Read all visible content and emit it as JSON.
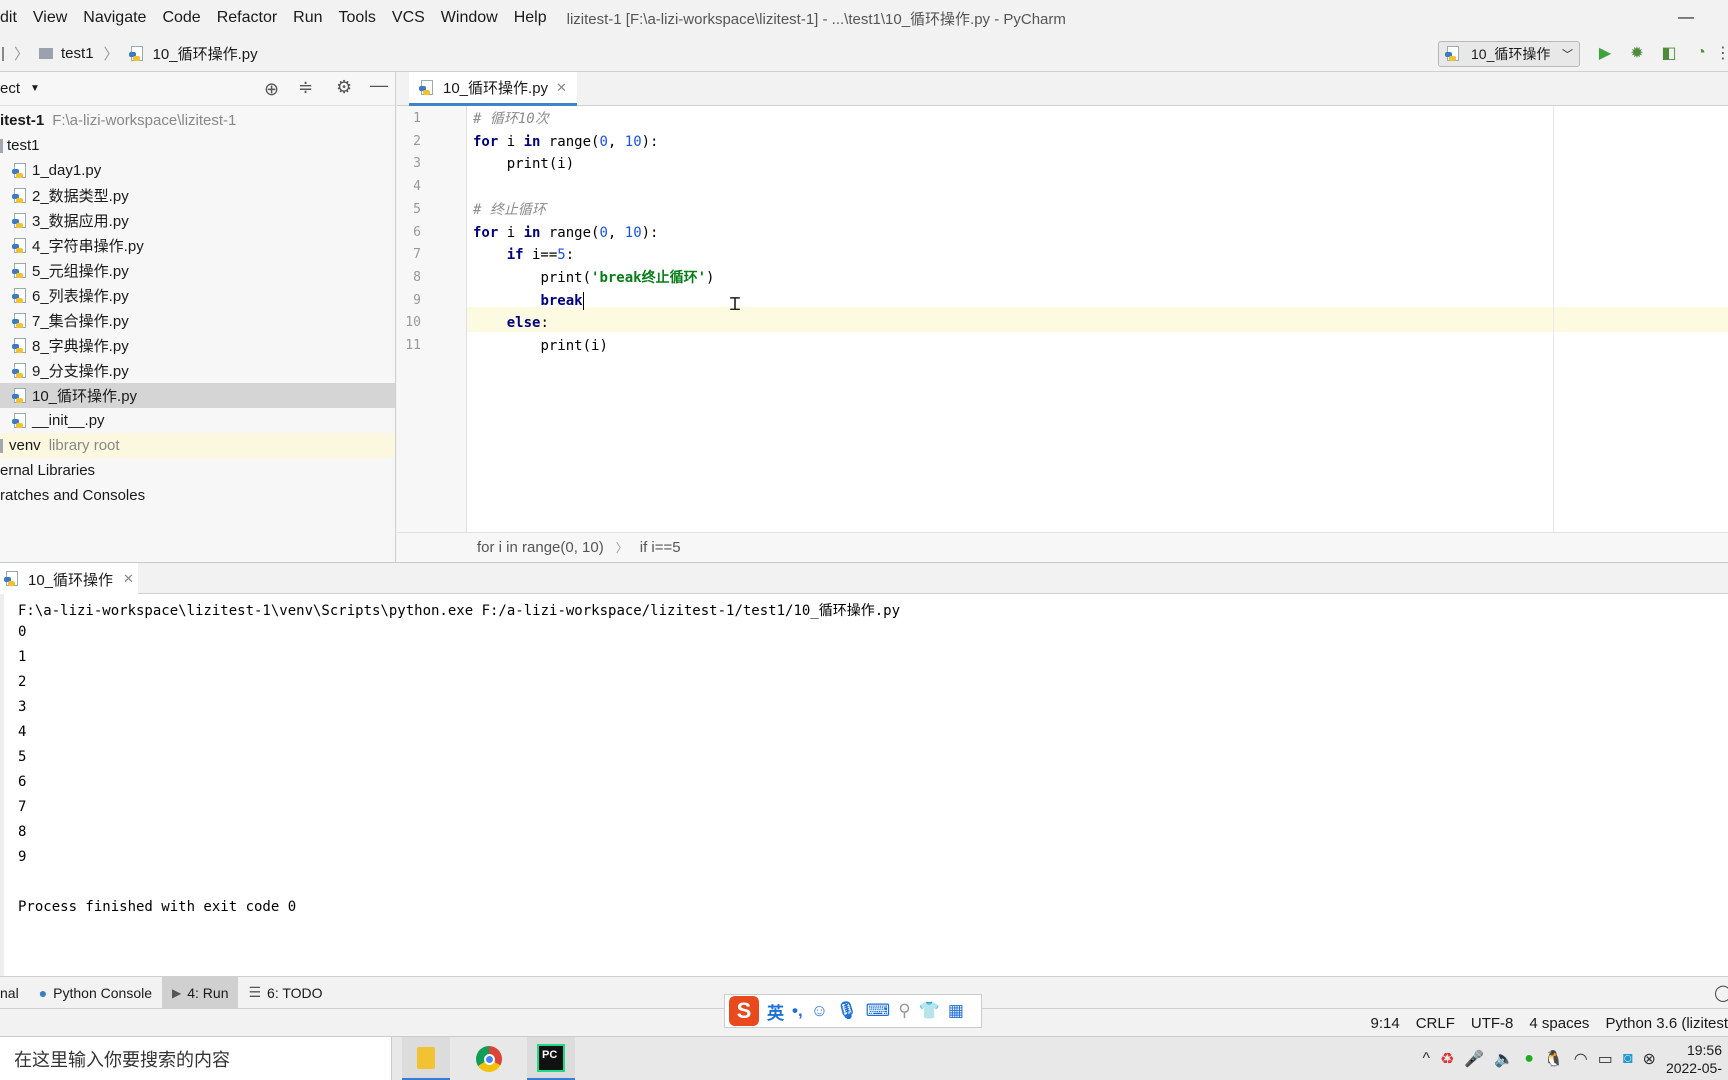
{
  "menubar": {
    "items": [
      "dit",
      "View",
      "Navigate",
      "Code",
      "Refactor",
      "Run",
      "Tools",
      "VCS",
      "Window",
      "Help"
    ],
    "title": "lizitest-1 [F:\\a-lizi-workspace\\lizitest-1] - ...\\test1\\10_循环操作.py - PyCharm",
    "minimize": "—"
  },
  "navbar": {
    "crumb_folder": "test1",
    "crumb_file": "10_循环操作.py",
    "run_config": "10_循环操作"
  },
  "project": {
    "header_label": "ect",
    "root_name": "itest-1",
    "root_path": "F:\\a-lizi-workspace\\lizitest-1",
    "folder": "test1",
    "files": [
      "1_day1.py",
      "2_数据类型.py",
      "3_数据应用.py",
      "4_字符串操作.py",
      "5_元组操作.py",
      "6_列表操作.py",
      "7_集合操作.py",
      "8_字典操作.py",
      "9_分支操作.py",
      "10_循环操作.py",
      "__init__.py"
    ],
    "selected_file": "10_循环操作.py",
    "venv_name": "venv",
    "venv_note": "library root",
    "external_libraries": "ernal Libraries",
    "scratches": "ratches and Consoles"
  },
  "editor": {
    "tab_label": "10_循环操作.py",
    "line_numbers": [
      "1",
      "2",
      "3",
      "4",
      "5",
      "6",
      "7",
      "8",
      "9",
      "10",
      "11"
    ],
    "lines": [
      {
        "indent": "",
        "tokens": [
          {
            "c": "cm",
            "t": "# 循环10次"
          }
        ]
      },
      {
        "indent": "",
        "tokens": [
          {
            "c": "kw",
            "t": "for"
          },
          {
            "c": "fn",
            "t": " i "
          },
          {
            "c": "kw",
            "t": "in"
          },
          {
            "c": "fn",
            "t": " range("
          },
          {
            "c": "num",
            "t": "0"
          },
          {
            "c": "fn",
            "t": ", "
          },
          {
            "c": "num",
            "t": "10"
          },
          {
            "c": "fn",
            "t": "):"
          }
        ]
      },
      {
        "indent": "    ",
        "tokens": [
          {
            "c": "fn",
            "t": "print(i)"
          }
        ]
      },
      {
        "indent": "",
        "tokens": []
      },
      {
        "indent": "",
        "tokens": [
          {
            "c": "cm",
            "t": "# 终止循环"
          }
        ]
      },
      {
        "indent": "",
        "tokens": [
          {
            "c": "kw",
            "t": "for"
          },
          {
            "c": "fn",
            "t": " i "
          },
          {
            "c": "kw",
            "t": "in"
          },
          {
            "c": "fn",
            "t": " range("
          },
          {
            "c": "num",
            "t": "0"
          },
          {
            "c": "fn",
            "t": ", "
          },
          {
            "c": "num",
            "t": "10"
          },
          {
            "c": "fn",
            "t": "):"
          }
        ]
      },
      {
        "indent": "    ",
        "tokens": [
          {
            "c": "kw",
            "t": "if"
          },
          {
            "c": "fn",
            "t": " i=="
          },
          {
            "c": "num",
            "t": "5"
          },
          {
            "c": "fn",
            "t": ":"
          }
        ]
      },
      {
        "indent": "        ",
        "tokens": [
          {
            "c": "fn",
            "t": "print("
          },
          {
            "c": "str",
            "t": "'break终止循环'"
          },
          {
            "c": "fn",
            "t": ")"
          }
        ]
      },
      {
        "indent": "        ",
        "tokens": [
          {
            "c": "kw",
            "t": "break"
          }
        ]
      },
      {
        "indent": "    ",
        "tokens": [
          {
            "c": "kw",
            "t": "else"
          },
          {
            "c": "fn",
            "t": ":"
          }
        ]
      },
      {
        "indent": "        ",
        "tokens": [
          {
            "c": "fn",
            "t": "print(i)"
          }
        ]
      }
    ],
    "breadcrumb_1": "for i in range(0, 10)",
    "breadcrumb_2": "if i==5"
  },
  "run": {
    "tab_label": "10_循环操作",
    "command": "F:\\a-lizi-workspace\\lizitest-1\\venv\\Scripts\\python.exe F:/a-lizi-workspace/lizitest-1/test1/10_循环操作.py",
    "output": [
      "0",
      "1",
      "2",
      "3",
      "4",
      "5",
      "6",
      "7",
      "8",
      "9"
    ],
    "finished": "Process finished with exit code 0"
  },
  "toolwindows": {
    "terminal": "nal",
    "python_console": "Python Console",
    "run": "4: Run",
    "todo": "6: TODO"
  },
  "status": {
    "position": "9:14",
    "line_sep": "CRLF",
    "encoding": "UTF-8",
    "indent": "4 spaces",
    "interpreter": "Python 3.6 (lizitest"
  },
  "ime": {
    "logo": "S",
    "lang": "英"
  },
  "taskbar": {
    "search_placeholder": "在这里输入你要搜索的内容",
    "time": "19:56",
    "date": "2022-05-"
  }
}
